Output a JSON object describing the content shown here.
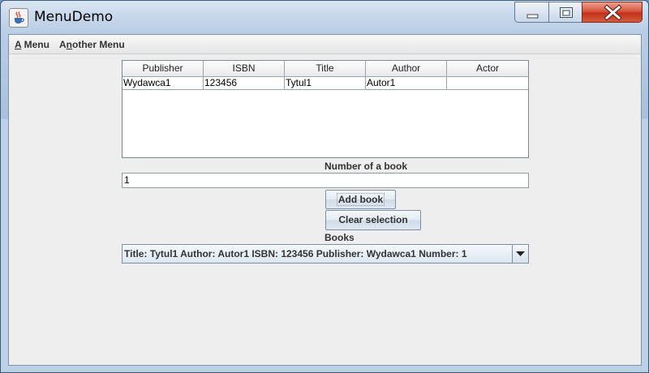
{
  "window": {
    "title": "MenuDemo"
  },
  "menubar": {
    "items": [
      {
        "label": "A Menu",
        "mnemonic": "A",
        "rest": " Menu"
      },
      {
        "label": "Another Menu",
        "pre": "A",
        "mnemonic": "n",
        "rest": "other Menu"
      }
    ]
  },
  "table": {
    "columns": [
      "Publisher",
      "ISBN",
      "Title",
      "Author",
      "Actor"
    ],
    "rows": [
      [
        "Wydawca1",
        "123456",
        "Tytul1",
        "Autor1",
        ""
      ]
    ]
  },
  "number_label": "Number of a book",
  "number_value": "1",
  "buttons": {
    "add": "Add book",
    "clear": "Clear selection"
  },
  "books_label": "Books",
  "books_combo": {
    "selected": "Title: Tytul1 Author: Autor1 ISBN: 123456 Publisher: Wydawca1 Number: 1"
  },
  "colors": {
    "titlebar": "#b9cde4",
    "client_bg": "#eeeeee",
    "close_button": "#c0311b"
  },
  "icons": {
    "app": "java-coffee-cup-icon",
    "minimize": "minimize-icon",
    "maximize": "maximize-icon",
    "close": "close-icon",
    "dropdown": "chevron-down-icon"
  }
}
